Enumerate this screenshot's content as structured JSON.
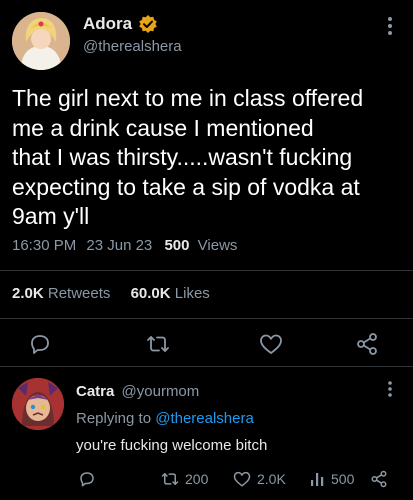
{
  "tweet": {
    "display_name": "Adora",
    "handle": "@therealshera",
    "text_lines": [
      "The girl next to me in class offered",
      "me a drink cause I mentioned",
      "that I was thirsty.....wasn't fucking",
      "expecting to take a sip of vodka at",
      "9am y'll"
    ],
    "time": "16:30 PM",
    "date": "23 Jun 23",
    "views_count": "500",
    "views_label": "Views",
    "retweets_count": "2.0K",
    "retweets_label": "Retweets",
    "likes_count": "60.0K",
    "likes_label": "Likes",
    "verified_badge_color": "#e8a317",
    "action_icons": [
      "reply-icon",
      "retweet-icon",
      "like-icon",
      "share-icon"
    ]
  },
  "reply": {
    "display_name": "Catra",
    "handle": "@yourmom",
    "replying_prefix": "Replying to",
    "replying_to": "@therealshera",
    "text": "you're fucking welcome bitch",
    "retweets": "200",
    "likes": "2.0K",
    "views": "500",
    "action_icons": [
      "reply-icon",
      "retweet-icon",
      "like-icon",
      "views-icon",
      "share-icon"
    ]
  },
  "colors": {
    "background": "#000000",
    "text": "#e7e9ea",
    "muted": "#8b98a5",
    "link": "#1d9bf0",
    "divider": "#2f3336"
  }
}
